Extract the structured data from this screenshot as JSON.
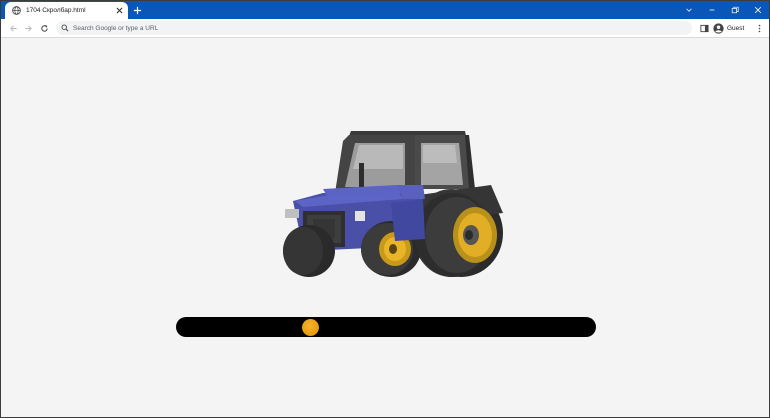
{
  "browser": {
    "tab": {
      "title": "1704 Скролбар.html",
      "favicon": "globe-icon"
    },
    "omnibox": {
      "placeholder": "Search Google or type a URL"
    },
    "profile": {
      "label": "Guest"
    },
    "colors": {
      "tabstrip": "#0b57b8",
      "toolbar": "#ffffff"
    }
  },
  "page": {
    "background": "#f4f4f4",
    "illustration": "tractor",
    "scrollbar": {
      "track_color": "#000000",
      "thumb_color": "#f0a31a",
      "position": 0.31
    }
  }
}
